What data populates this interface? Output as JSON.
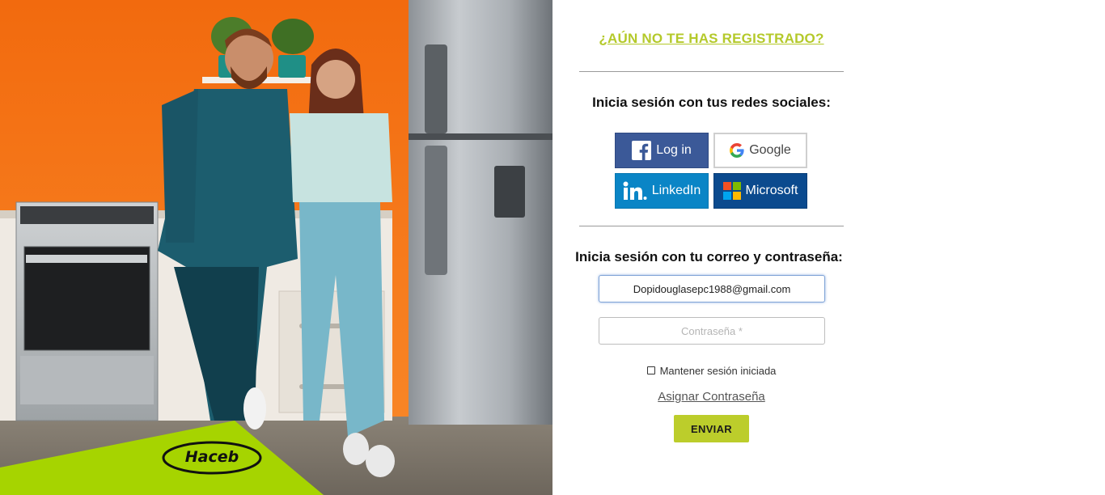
{
  "register": {
    "label": "¿AÚN NO TE HAS REGISTRADO?"
  },
  "social": {
    "title": "Inicia sesión con tus redes sociales:",
    "facebook_label": "Log in",
    "google_label": "Google",
    "linkedin_label": "LinkedIn",
    "microsoft_label": "Microsoft"
  },
  "login": {
    "title": "Inicia sesión con tu correo y contraseña:",
    "email_value": "Dopidouglasepc1988@gmail.com",
    "password_placeholder": "Contraseña *",
    "remember_label": "Mantener sesión iniciada",
    "assign_password_label": "Asignar Contraseña",
    "submit_label": "ENVIAR"
  },
  "brand": {
    "logo_text": "Haceb",
    "accent_color": "#bccd2b",
    "logo_badge_color": "#a6d400"
  },
  "icons": [
    "facebook-icon",
    "google-icon",
    "linkedin-icon",
    "microsoft-icon",
    "checkbox-icon"
  ]
}
